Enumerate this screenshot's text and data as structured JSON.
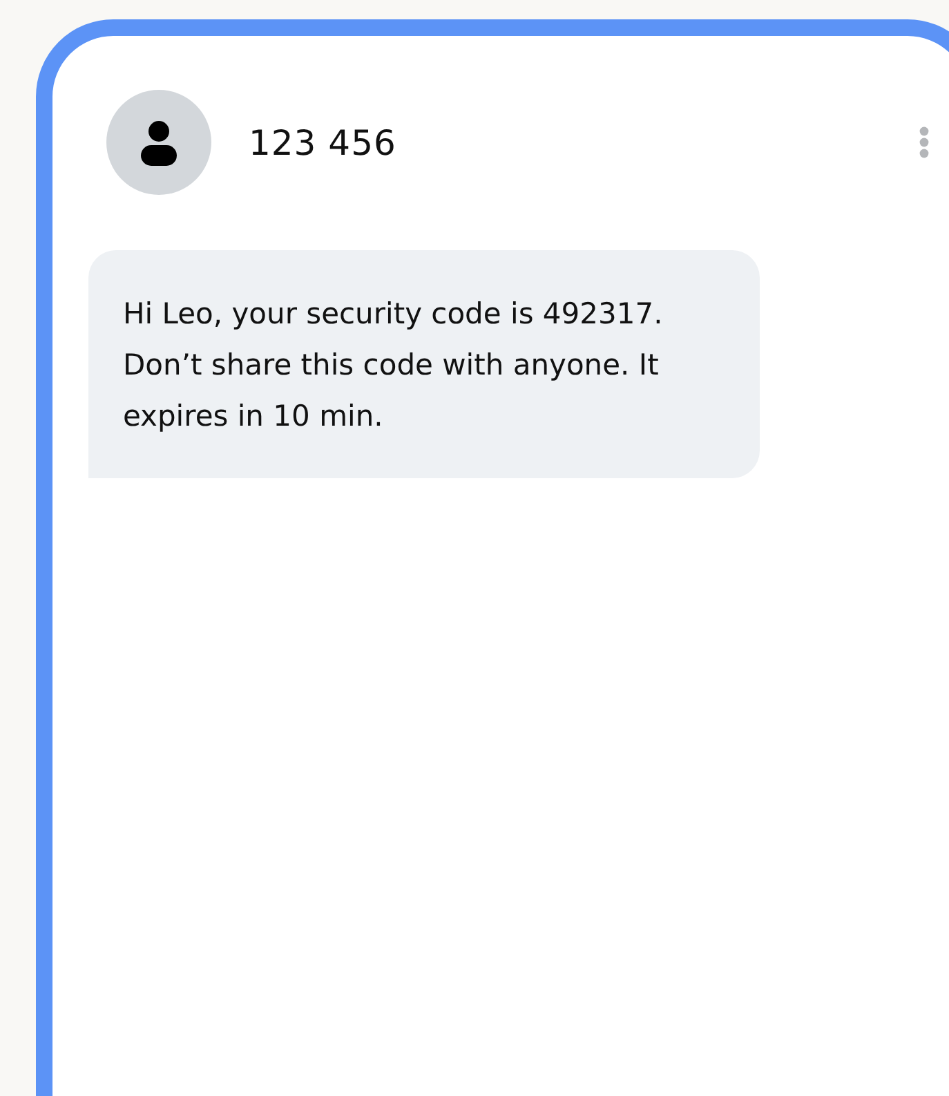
{
  "contact": {
    "name": "123 456"
  },
  "messages": [
    {
      "kind": "incoming",
      "text": "Hi Leo, your security code is 492317. Don’t share this code with anyone. It expires in 10 min."
    }
  ]
}
